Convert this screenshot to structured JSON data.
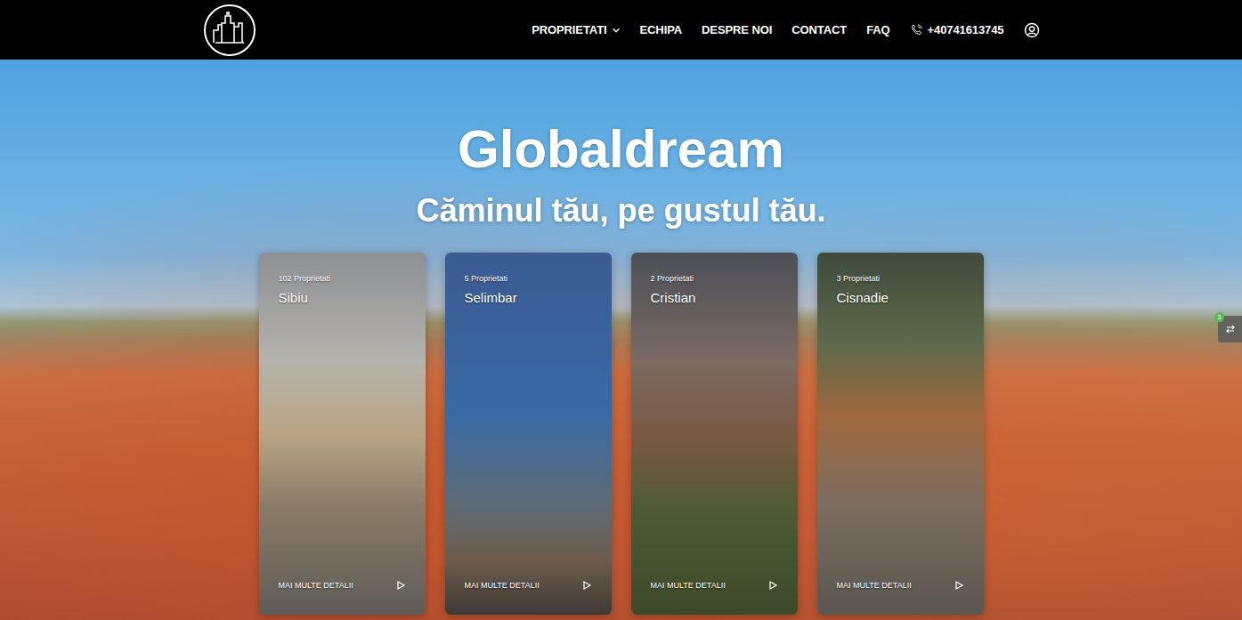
{
  "navbar": {
    "menu": [
      {
        "label": "PROPRIETATI",
        "dropdown": true
      },
      {
        "label": "ECHIPA",
        "dropdown": false
      },
      {
        "label": "DESPRE NOI",
        "dropdown": false
      },
      {
        "label": "CONTACT",
        "dropdown": false
      },
      {
        "label": "FAQ",
        "dropdown": false
      }
    ],
    "phone": "+40741613745"
  },
  "hero": {
    "title": "Globaldream",
    "subtitle": "Căminul tău, pe gustul tău."
  },
  "locations": [
    {
      "count": "102 Proprietati",
      "name": "Sibiu",
      "link": "MAI MULTE DETALII"
    },
    {
      "count": "5 Proprietati",
      "name": "Selimbar",
      "link": "MAI MULTE DETALII"
    },
    {
      "count": "2 Proprietati",
      "name": "Cristian",
      "link": "MAI MULTE DETALII"
    },
    {
      "count": "3 Proprietati",
      "name": "Cisnadie",
      "link": "MAI MULTE DETALII"
    }
  ],
  "side_widget": {
    "badge": "3"
  }
}
